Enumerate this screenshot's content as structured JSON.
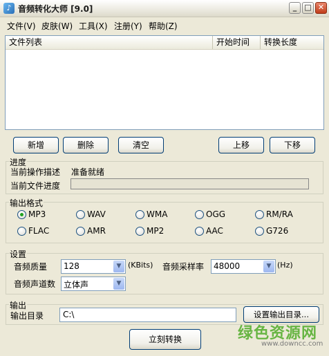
{
  "window": {
    "title": "音频转化大师 [9.0]",
    "icon": "music-note-icon",
    "min_symbol": "_",
    "max_symbol": "□",
    "close_symbol": "✕"
  },
  "menu": {
    "items": [
      "文件(V)",
      "皮肤(W)",
      "工具(X)",
      "注册(Y)",
      "帮助(Z)"
    ]
  },
  "file_list": {
    "columns": [
      "文件列表",
      "开始时间",
      "转换长度"
    ],
    "rows": []
  },
  "list_buttons": {
    "add": "新增",
    "delete": "删除",
    "clear": "清空",
    "move_up": "上移",
    "move_down": "下移"
  },
  "progress": {
    "caption": "进度",
    "operation_label": "当前操作描述",
    "operation_value": "准备就绪",
    "file_progress_label": "当前文件进度",
    "file_progress_fraction": 0
  },
  "output_format": {
    "caption": "输出格式",
    "options": [
      "MP3",
      "WAV",
      "WMA",
      "OGG",
      "RM/RA",
      "FLAC",
      "AMR",
      "MP2",
      "AAC",
      "G726"
    ],
    "selected": "MP3"
  },
  "settings": {
    "caption": "设置",
    "quality_label": "音频质量",
    "quality_value": "128",
    "quality_unit": "(KBits)",
    "sample_rate_label": "音频采样率",
    "sample_rate_value": "48000",
    "sample_rate_unit": "(Hz)",
    "channels_label": "音频声道数",
    "channels_value": "立体声"
  },
  "output": {
    "caption": "输出",
    "dir_label": "输出目录",
    "dir_value": "C:\\",
    "set_dir_button": "设置输出目录..."
  },
  "convert_button": "立刻转换",
  "watermark": {
    "text": "绿色资源网",
    "url": "www.downcc.com"
  },
  "colors": {
    "window_bg": "#ECE9D8",
    "radio_checked": "#21A121",
    "watermark": "#67B543"
  }
}
